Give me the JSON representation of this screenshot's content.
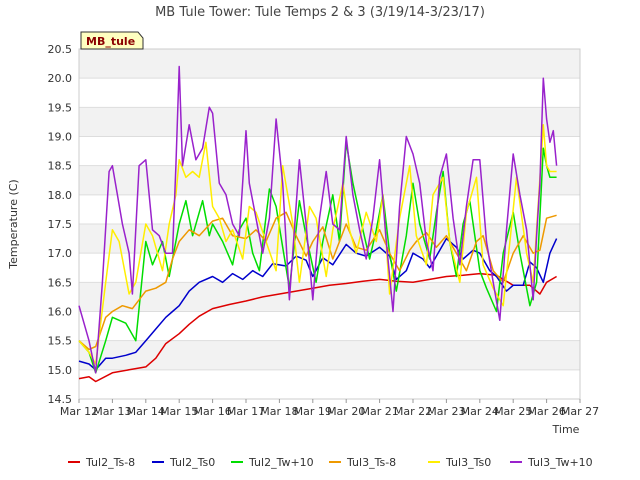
{
  "chart_data": {
    "type": "line",
    "title": "MB Tule Tower: Tule Temps 2 & 3 (3/19/14-3/23/17)",
    "xlabel": "Time",
    "ylabel": "Temperature (C)",
    "badge": "MB_tule",
    "xlim": [
      12,
      27
    ],
    "ylim": [
      14.5,
      20.5
    ],
    "x_ticks": [
      {
        "v": 12,
        "label": "Mar 12"
      },
      {
        "v": 13,
        "label": "Mar 13"
      },
      {
        "v": 14,
        "label": "Mar 14"
      },
      {
        "v": 15,
        "label": "Mar 15"
      },
      {
        "v": 16,
        "label": "Mar 16"
      },
      {
        "v": 17,
        "label": "Mar 17"
      },
      {
        "v": 18,
        "label": "Mar 18"
      },
      {
        "v": 19,
        "label": "Mar 19"
      },
      {
        "v": 20,
        "label": "Mar 20"
      },
      {
        "v": 21,
        "label": "Mar 21"
      },
      {
        "v": 22,
        "label": "Mar 22"
      },
      {
        "v": 23,
        "label": "Mar 23"
      },
      {
        "v": 24,
        "label": "Mar 24"
      },
      {
        "v": 25,
        "label": "Mar 25"
      },
      {
        "v": 26,
        "label": "Mar 26"
      },
      {
        "v": 27,
        "label": "Mar 27"
      }
    ],
    "y_ticks": [
      "14.5",
      "15.0",
      "15.5",
      "16.0",
      "16.5",
      "17.0",
      "17.5",
      "18.0",
      "18.5",
      "19.0",
      "19.5",
      "20.0",
      "20.5"
    ],
    "grid": true,
    "legend_position": "bottom",
    "series": [
      {
        "name": "Tul2_Ts-8",
        "color": "#dd0000",
        "x": [
          12.0,
          12.3,
          12.5,
          13.0,
          13.5,
          14.0,
          14.3,
          14.6,
          15.0,
          15.3,
          15.6,
          16.0,
          16.5,
          17.0,
          17.5,
          18.0,
          18.5,
          19.0,
          19.5,
          20.0,
          20.5,
          21.0,
          21.5,
          22.0,
          22.5,
          23.0,
          23.5,
          24.0,
          24.5,
          25.0,
          25.5,
          25.8,
          26.0,
          26.3
        ],
        "y": [
          14.85,
          14.88,
          14.8,
          14.95,
          15.0,
          15.05,
          15.2,
          15.45,
          15.62,
          15.78,
          15.92,
          16.05,
          16.12,
          16.18,
          16.25,
          16.3,
          16.35,
          16.4,
          16.45,
          16.48,
          16.52,
          16.55,
          16.52,
          16.5,
          16.55,
          16.6,
          16.62,
          16.65,
          16.62,
          16.45,
          16.45,
          16.3,
          16.5,
          16.6
        ]
      },
      {
        "name": "Tul2_Ts0",
        "color": "#0000cc",
        "x": [
          12.0,
          12.3,
          12.5,
          12.8,
          13.0,
          13.4,
          13.7,
          14.0,
          14.3,
          14.6,
          14.8,
          15.0,
          15.3,
          15.6,
          16.0,
          16.3,
          16.6,
          16.9,
          17.2,
          17.5,
          17.8,
          18.2,
          18.5,
          18.8,
          19.0,
          19.3,
          19.6,
          20.0,
          20.3,
          20.6,
          21.0,
          21.3,
          21.5,
          21.8,
          22.0,
          22.3,
          22.5,
          22.7,
          23.0,
          23.3,
          23.5,
          23.8,
          24.0,
          24.3,
          24.5,
          24.8,
          25.0,
          25.3,
          25.5,
          25.7,
          25.9,
          26.1,
          26.3
        ],
        "y": [
          15.15,
          15.1,
          15.0,
          15.2,
          15.2,
          15.25,
          15.3,
          15.5,
          15.7,
          15.9,
          16.0,
          16.1,
          16.35,
          16.5,
          16.6,
          16.5,
          16.65,
          16.55,
          16.7,
          16.6,
          16.82,
          16.78,
          16.95,
          16.88,
          16.6,
          16.92,
          16.8,
          17.15,
          17.0,
          16.95,
          17.1,
          16.95,
          16.55,
          16.7,
          17.0,
          16.9,
          16.75,
          16.95,
          17.25,
          17.1,
          16.9,
          17.05,
          17.0,
          16.7,
          16.6,
          16.35,
          16.45,
          16.45,
          16.85,
          16.75,
          16.5,
          17.0,
          17.25
        ]
      },
      {
        "name": "Tul2_Tw+10",
        "color": "#00dd00",
        "x": [
          12.0,
          12.3,
          12.5,
          12.8,
          13.0,
          13.4,
          13.7,
          14.0,
          14.2,
          14.5,
          14.7,
          15.0,
          15.2,
          15.4,
          15.7,
          15.9,
          16.0,
          16.3,
          16.6,
          16.8,
          17.0,
          17.2,
          17.4,
          17.7,
          17.9,
          18.1,
          18.3,
          18.6,
          18.8,
          19.1,
          19.3,
          19.6,
          19.8,
          20.0,
          20.2,
          20.5,
          20.7,
          20.9,
          21.1,
          21.3,
          21.5,
          21.8,
          22.0,
          22.2,
          22.5,
          22.7,
          22.9,
          23.1,
          23.3,
          23.5,
          23.7,
          24.0,
          24.2,
          24.5,
          24.7,
          25.0,
          25.2,
          25.5,
          25.7,
          25.9,
          26.0,
          26.1,
          26.3
        ],
        "y": [
          15.5,
          15.3,
          14.95,
          15.5,
          15.9,
          15.8,
          15.5,
          17.2,
          16.8,
          17.2,
          16.6,
          17.5,
          17.9,
          17.3,
          17.9,
          17.3,
          17.5,
          17.2,
          16.8,
          17.4,
          17.6,
          17.0,
          16.7,
          18.1,
          17.8,
          17.1,
          16.4,
          17.9,
          17.3,
          16.5,
          17.2,
          18.0,
          17.2,
          18.9,
          18.2,
          17.4,
          16.9,
          17.4,
          18.0,
          17.0,
          16.35,
          17.3,
          18.2,
          17.5,
          16.9,
          17.7,
          18.4,
          17.2,
          16.6,
          17.5,
          17.9,
          16.7,
          16.4,
          16.0,
          17.0,
          17.7,
          17.0,
          16.1,
          16.5,
          18.8,
          18.5,
          18.3,
          18.3
        ]
      },
      {
        "name": "Tul3_Ts-8",
        "color": "#ee9900",
        "x": [
          12.0,
          12.3,
          12.5,
          12.8,
          13.0,
          13.3,
          13.6,
          13.8,
          14.0,
          14.3,
          14.6,
          14.8,
          15.0,
          15.3,
          15.6,
          16.0,
          16.3,
          16.6,
          17.0,
          17.3,
          17.6,
          17.9,
          18.2,
          18.5,
          18.8,
          19.0,
          19.3,
          19.6,
          20.0,
          20.3,
          20.6,
          21.0,
          21.3,
          21.6,
          21.9,
          22.1,
          22.4,
          22.7,
          23.0,
          23.3,
          23.6,
          23.9,
          24.1,
          24.4,
          24.7,
          25.0,
          25.3,
          25.6,
          25.8,
          26.0,
          26.3
        ],
        "y": [
          15.5,
          15.35,
          15.4,
          15.9,
          16.0,
          16.1,
          16.05,
          16.2,
          16.35,
          16.4,
          16.5,
          16.9,
          17.2,
          17.4,
          17.3,
          17.55,
          17.6,
          17.3,
          17.25,
          17.4,
          17.2,
          17.6,
          17.7,
          17.3,
          16.95,
          17.2,
          17.45,
          16.9,
          17.5,
          17.1,
          17.05,
          17.4,
          17.0,
          16.7,
          17.05,
          17.2,
          17.35,
          17.1,
          17.3,
          17.0,
          16.7,
          17.2,
          17.3,
          16.7,
          16.5,
          17.0,
          17.3,
          17.0,
          17.05,
          17.6,
          17.65
        ]
      },
      {
        "name": "Tul3_Ts0",
        "color": "#ffee00",
        "x": [
          12.0,
          12.3,
          12.5,
          12.8,
          13.0,
          13.2,
          13.5,
          13.7,
          14.0,
          14.2,
          14.5,
          14.7,
          14.9,
          15.0,
          15.2,
          15.4,
          15.6,
          15.8,
          16.0,
          16.2,
          16.4,
          16.6,
          16.9,
          17.1,
          17.3,
          17.6,
          17.9,
          18.1,
          18.4,
          18.6,
          18.9,
          19.1,
          19.4,
          19.6,
          19.9,
          20.1,
          20.3,
          20.6,
          20.9,
          21.1,
          21.3,
          21.6,
          21.9,
          22.1,
          22.4,
          22.6,
          22.9,
          23.1,
          23.4,
          23.6,
          23.9,
          24.1,
          24.4,
          24.7,
          24.9,
          25.1,
          25.4,
          25.6,
          25.9,
          26.0,
          26.1,
          26.3
        ],
        "y": [
          15.5,
          15.3,
          15.1,
          16.5,
          17.4,
          17.2,
          16.3,
          16.5,
          17.5,
          17.3,
          16.7,
          17.5,
          18.0,
          18.6,
          18.3,
          18.4,
          18.3,
          18.9,
          17.8,
          17.6,
          17.2,
          17.4,
          16.9,
          17.8,
          17.7,
          17.2,
          16.7,
          18.5,
          17.5,
          16.5,
          17.8,
          17.6,
          16.6,
          17.4,
          18.2,
          17.4,
          17.0,
          17.7,
          17.2,
          18.0,
          16.3,
          17.6,
          18.5,
          17.3,
          16.8,
          18.0,
          18.3,
          17.2,
          16.5,
          17.7,
          18.3,
          16.8,
          16.4,
          16.1,
          17.2,
          18.3,
          17.0,
          16.5,
          19.2,
          18.5,
          18.4,
          18.4
        ]
      },
      {
        "name": "Tul3_Tw+10",
        "color": "#9922cc",
        "x": [
          12.0,
          12.15,
          12.3,
          12.5,
          12.7,
          12.9,
          13.0,
          13.15,
          13.3,
          13.5,
          13.6,
          13.8,
          14.0,
          14.2,
          14.4,
          14.6,
          14.8,
          14.9,
          15.0,
          15.1,
          15.3,
          15.5,
          15.7,
          15.9,
          16.0,
          16.2,
          16.4,
          16.6,
          16.8,
          17.0,
          17.1,
          17.3,
          17.5,
          17.7,
          17.9,
          18.1,
          18.3,
          18.6,
          18.8,
          19.0,
          19.2,
          19.4,
          19.6,
          19.8,
          20.0,
          20.2,
          20.4,
          20.6,
          20.8,
          21.0,
          21.2,
          21.4,
          21.6,
          21.8,
          22.0,
          22.2,
          22.4,
          22.6,
          22.8,
          23.0,
          23.2,
          23.4,
          23.6,
          23.8,
          24.0,
          24.2,
          24.4,
          24.6,
          24.8,
          25.0,
          25.2,
          25.4,
          25.6,
          25.7,
          25.8,
          25.9,
          26.0,
          26.1,
          26.2,
          26.3
        ],
        "y": [
          16.1,
          15.8,
          15.5,
          14.95,
          16.5,
          18.4,
          18.5,
          18.0,
          17.5,
          17.0,
          16.3,
          18.5,
          18.6,
          17.4,
          17.3,
          17.0,
          17.0,
          18.5,
          20.2,
          18.5,
          19.2,
          18.6,
          18.8,
          19.5,
          19.4,
          18.2,
          18.0,
          17.5,
          17.3,
          19.1,
          18.2,
          17.6,
          17.0,
          17.6,
          19.3,
          18.2,
          16.2,
          18.6,
          17.5,
          16.2,
          17.6,
          18.4,
          17.5,
          17.4,
          19.0,
          18.0,
          17.4,
          16.9,
          17.6,
          18.6,
          17.2,
          16.0,
          17.8,
          19.0,
          18.7,
          18.2,
          17.2,
          16.7,
          18.3,
          18.7,
          17.6,
          16.8,
          17.8,
          18.6,
          18.6,
          17.2,
          16.5,
          15.85,
          17.4,
          18.7,
          18.0,
          17.4,
          16.2,
          17.3,
          18.2,
          20.0,
          19.3,
          18.9,
          19.1,
          18.5
        ]
      }
    ]
  }
}
